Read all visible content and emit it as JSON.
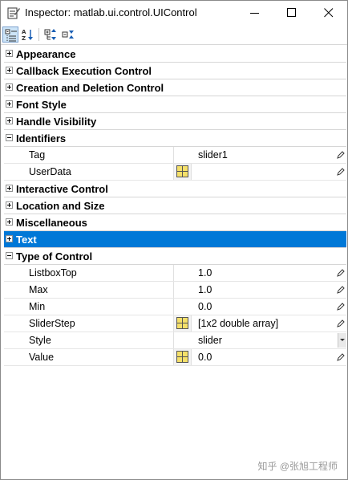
{
  "window": {
    "title": "Inspector:  matlab.ui.control.UIControl",
    "icon": "inspector-icon"
  },
  "toolbar": {
    "buttons": [
      "categorized-view-icon",
      "alphabetical-sort-icon",
      "expand-all-icon",
      "collapse-all-icon"
    ]
  },
  "groups": [
    {
      "label": "Appearance",
      "expanded": false
    },
    {
      "label": "Callback Execution Control",
      "expanded": false
    },
    {
      "label": "Creation and Deletion Control",
      "expanded": false
    },
    {
      "label": "Font Style",
      "expanded": false
    },
    {
      "label": "Handle Visibility",
      "expanded": false
    },
    {
      "label": "Identifiers",
      "expanded": true,
      "properties": [
        {
          "name": "Tag",
          "value": "slider1"
        },
        {
          "name": "UserData",
          "value": ""
        }
      ]
    },
    {
      "label": "Interactive Control",
      "expanded": false
    },
    {
      "label": "Location and Size",
      "expanded": false
    },
    {
      "label": "Miscellaneous",
      "expanded": false
    },
    {
      "label": "Text",
      "expanded": false,
      "selected": true
    },
    {
      "label": "Type of Control",
      "expanded": true,
      "properties": [
        {
          "name": "ListboxTop",
          "value": "1.0"
        },
        {
          "name": "Max",
          "value": "1.0"
        },
        {
          "name": "Min",
          "value": "0.0"
        },
        {
          "name": "SliderStep",
          "value": "[1x2  double array]"
        },
        {
          "name": "Style",
          "value": "slider"
        },
        {
          "name": "Value",
          "value": "0.0"
        }
      ]
    }
  ],
  "watermark": "知乎 @张旭工程师",
  "colors": {
    "selection": "#0078d7",
    "table_icon": "#f5e06a"
  }
}
